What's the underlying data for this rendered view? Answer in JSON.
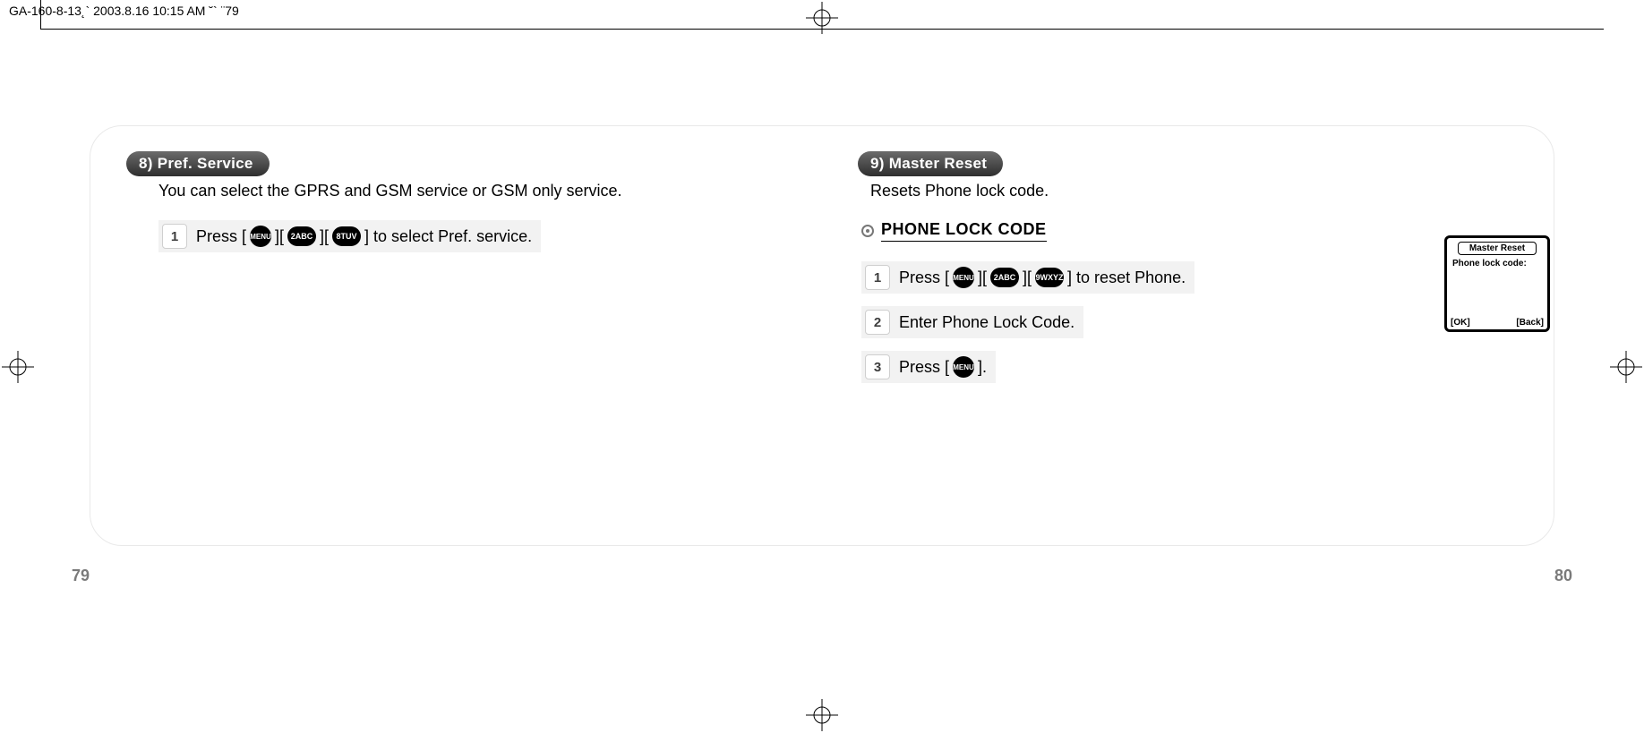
{
  "print": {
    "job_info": "GA-160-8-13˛`   2003.8.16 10:15 AM   ˘` ¨79"
  },
  "left": {
    "pill": "8) Pref. Service",
    "desc": "You can select the GPRS and GSM service or GSM only service.",
    "steps": [
      {
        "num": "1",
        "pre": "Press [",
        "key1": "MENU",
        "sep1": "][",
        "key2": "2ABC",
        "sep2": "][",
        "key3": "8TUV",
        "post": "] to select Pref. service."
      }
    ]
  },
  "right": {
    "pill": "9) Master Reset",
    "desc": "Resets Phone lock code.",
    "subhead": "PHONE LOCK CODE",
    "steps": [
      {
        "num": "1",
        "pre": "Press [",
        "key1": "MENU",
        "sep1": "][",
        "key2": "2ABC",
        "sep2": "][",
        "key3": "9WXYZ",
        "post": "] to reset Phone."
      },
      {
        "num": "2",
        "text": "Enter Phone Lock Code."
      },
      {
        "num": "3",
        "pre": "Press [",
        "key1": "MENU",
        "post": "]."
      }
    ],
    "phone": {
      "title": "Master Reset",
      "line1": "Phone lock code:",
      "sk_left": "[OK]",
      "sk_right": "[Back]"
    }
  },
  "pages": {
    "left": "79",
    "right": "80"
  }
}
